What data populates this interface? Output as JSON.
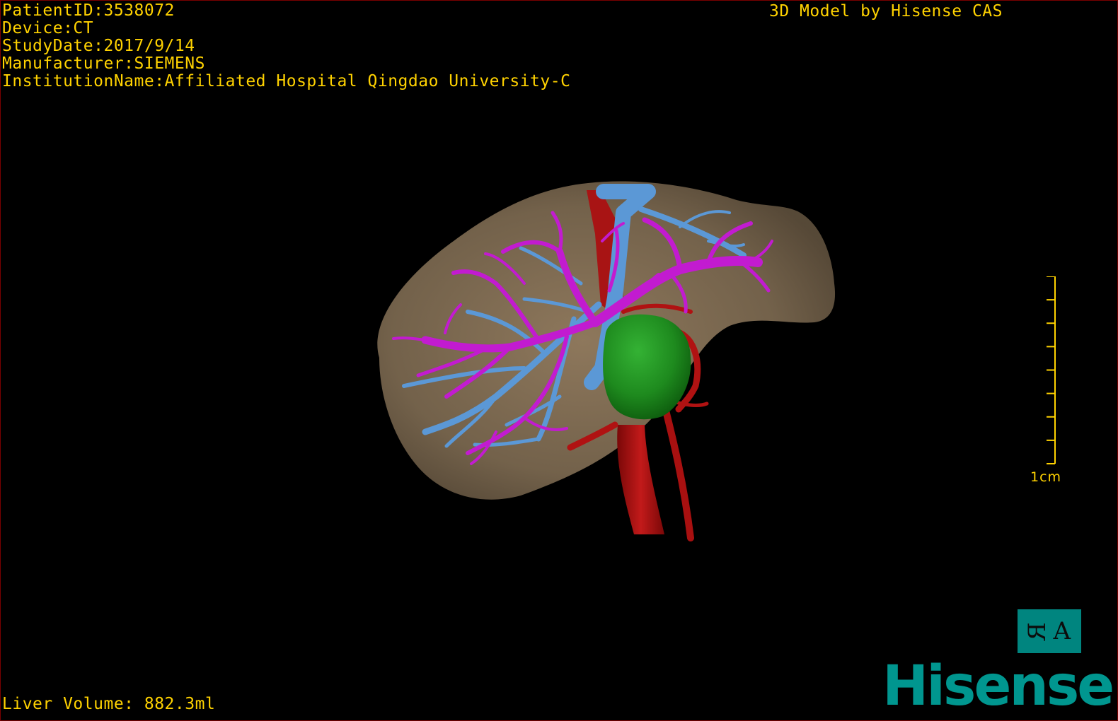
{
  "info": {
    "patient_id": "PatientID:3538072",
    "device": "Device:CT",
    "study_date": "StudyDate:2017/9/14",
    "manufacturer": "Manufacturer:SIEMENS",
    "institution": "InstitutionName:Affiliated Hospital Qingdao University-C"
  },
  "brand_label": "3D Model by Hisense CAS",
  "liver_volume": "Liver Volume: 882.3ml",
  "scale": {
    "label": "1cm",
    "ticks": 9
  },
  "orientation": {
    "left_glyph": "R",
    "right_glyph": "A"
  },
  "logo": "Hisense",
  "colors": {
    "overlay_text": "#ffd200",
    "liver": "#8a7458",
    "hepatic_vein": "#5b98d6",
    "portal_vein": "#c21bd0",
    "artery": "#b01212",
    "tumor": "#1e8a1e",
    "logo": "#00968f"
  }
}
